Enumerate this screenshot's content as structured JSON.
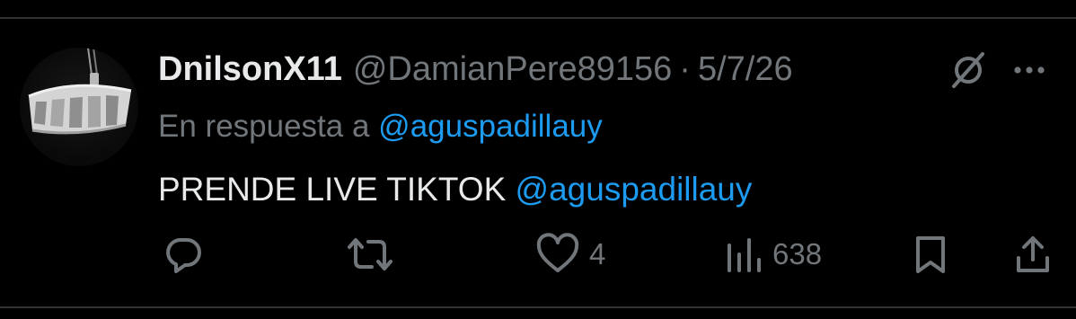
{
  "tweet": {
    "display_name": "DnilsonX11",
    "handle": "@DamianPere89156",
    "separator": "·",
    "date": "5/7/26",
    "reply_prefix": "En respuesta a",
    "reply_to": "@aguspadillauy",
    "text": "PRENDE LIVE TIKTOK",
    "text_mention": "@aguspadillauy"
  },
  "actions": {
    "reply_icon": "reply-icon",
    "retweet_icon": "retweet-icon",
    "like_icon": "heart-icon",
    "like_count": "4",
    "views_icon": "views-chart-icon",
    "views_count": "638",
    "bookmark_icon": "bookmark-icon",
    "share_icon": "share-upload-icon"
  },
  "header_icons": {
    "grok": "grok-icon",
    "more": "more-dots-icon"
  },
  "colors": {
    "background": "#000000",
    "primary_text": "#e7e9ea",
    "secondary_text": "#71767b",
    "link": "#1d9bf0",
    "divider": "#2f3336"
  }
}
